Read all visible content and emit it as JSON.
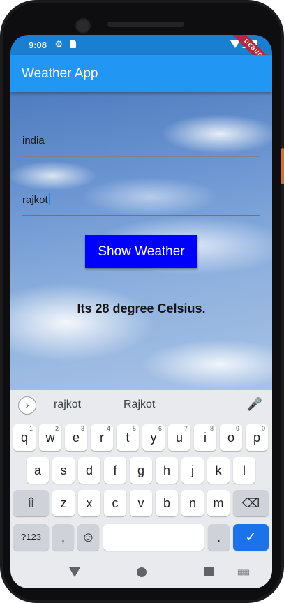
{
  "status": {
    "time": "9:08",
    "debug_banner": "DEBUG"
  },
  "appbar": {
    "title": "Weather App"
  },
  "form": {
    "country_value": "india",
    "city_value": "rajkot",
    "button_label": "Show Weather"
  },
  "result": {
    "text": "Its 28 degree Celsius."
  },
  "keyboard": {
    "suggestions": [
      "rajkot",
      "Rajkot"
    ],
    "row1": [
      {
        "key": "q",
        "hint": "1"
      },
      {
        "key": "w",
        "hint": "2"
      },
      {
        "key": "e",
        "hint": "3"
      },
      {
        "key": "r",
        "hint": "4"
      },
      {
        "key": "t",
        "hint": "5"
      },
      {
        "key": "y",
        "hint": "6"
      },
      {
        "key": "u",
        "hint": "7"
      },
      {
        "key": "i",
        "hint": "8"
      },
      {
        "key": "o",
        "hint": "9"
      },
      {
        "key": "p",
        "hint": "0"
      }
    ],
    "row2": [
      "a",
      "s",
      "d",
      "f",
      "g",
      "h",
      "j",
      "k",
      "l"
    ],
    "row3": [
      "z",
      "x",
      "c",
      "v",
      "b",
      "n",
      "m"
    ],
    "symbols_label": "?123",
    "comma_label": ",",
    "period_label": "."
  }
}
